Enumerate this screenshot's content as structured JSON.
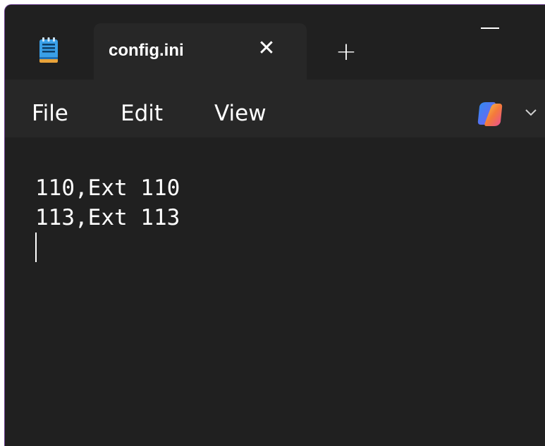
{
  "tab": {
    "title": "config.ini",
    "close_glyph": "✕",
    "new_tab_glyph": "+"
  },
  "menu": {
    "items": [
      {
        "label": "File"
      },
      {
        "label": "Edit"
      },
      {
        "label": "View"
      }
    ]
  },
  "editor": {
    "lines": [
      "110,Ext 110",
      "113,Ext 113"
    ]
  },
  "icons": {
    "app": "notepad-icon",
    "copilot": "copilot-icon",
    "copilot_menu": "chevron-down-icon",
    "minimize": "minimize-icon"
  },
  "colors": {
    "window_bg": "#202020",
    "tab_bg": "#272727",
    "menubar_bg": "#272727",
    "text": "#ffffff",
    "notepad_blue": "#3aa0e8",
    "window_border": "#6a3f8f"
  }
}
